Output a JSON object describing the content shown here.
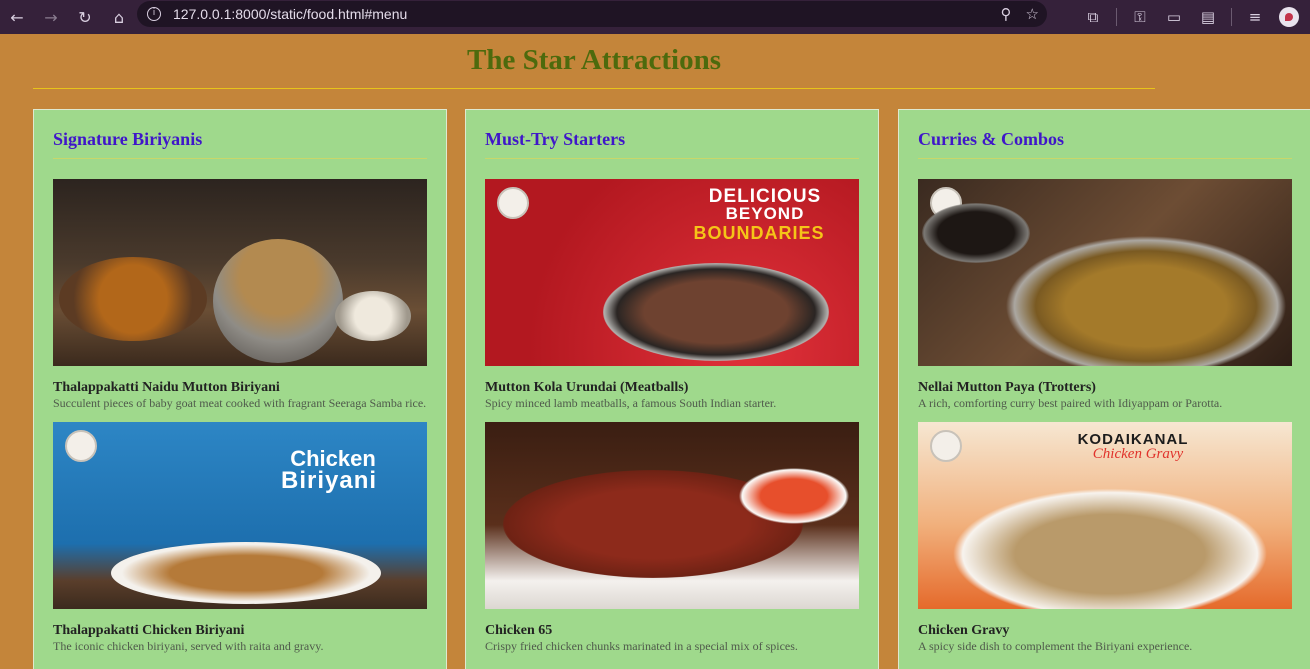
{
  "browser": {
    "url": "127.0.0.1:8000/static/food.html#menu"
  },
  "page": {
    "title": "The Star Attractions"
  },
  "columns": [
    {
      "heading": "Signature Biriyanis",
      "dishes": [
        {
          "name": "Thalappakatti Naidu Mutton Biriyani",
          "description": "Succulent pieces of baby goat meat cooked with fragrant Seeraga Samba rice."
        },
        {
          "name": "Thalappakatti Chicken Biriyani",
          "description": "The iconic chicken biriyani, served with raita and gravy.",
          "image_text": [
            "Chicken",
            "Biriyani"
          ]
        }
      ]
    },
    {
      "heading": "Must-Try Starters",
      "dishes": [
        {
          "name": "Mutton Kola Urundai (Meatballs)",
          "description": "Spicy minced lamb meatballs, a famous South Indian starter.",
          "image_text": [
            "DELICIOUS",
            "BEYOND",
            "BOUNDARIES"
          ]
        },
        {
          "name": "Chicken 65",
          "description": "Crispy fried chicken chunks marinated in a special mix of spices."
        }
      ]
    },
    {
      "heading": "Curries & Combos",
      "dishes": [
        {
          "name": "Nellai Mutton Paya (Trotters)",
          "description": "A rich, comforting curry best paired with Idiyappam or Parotta."
        },
        {
          "name": "Chicken Gravy",
          "description": "A spicy side dish to complement the Biriyani experience.",
          "image_text": [
            "KODAIKANAL",
            "Chicken Gravy"
          ]
        }
      ]
    }
  ],
  "colors": {
    "page_bg": "#c4853a",
    "title": "#4d6a0d",
    "card_bg": "#9fd98c",
    "heading": "#3f16c9",
    "accent_rule": "#e8c419"
  }
}
